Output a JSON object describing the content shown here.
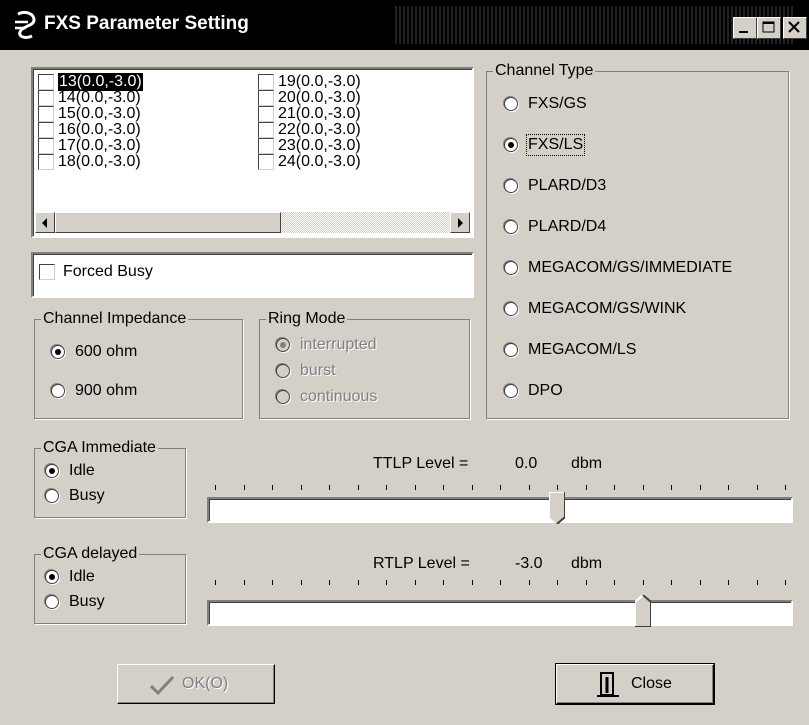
{
  "window": {
    "title": "FXS Parameter Setting"
  },
  "channels": {
    "left": [
      "13(0.0,-3.0)",
      "14(0.0,-3.0)",
      "15(0.0,-3.0)",
      "16(0.0,-3.0)",
      "17(0.0,-3.0)",
      "18(0.0,-3.0)"
    ],
    "right": [
      "19(0.0,-3.0)",
      "20(0.0,-3.0)",
      "21(0.0,-3.0)",
      "22(0.0,-3.0)",
      "23(0.0,-3.0)",
      "24(0.0,-3.0)"
    ],
    "selected": "13(0.0,-3.0)"
  },
  "forced_busy": {
    "label": "Forced Busy",
    "checked": false
  },
  "impedance": {
    "title": "Channel Impedance",
    "options": [
      "600 ohm",
      "900 ohm"
    ],
    "selected": "600 ohm"
  },
  "ring_mode": {
    "title": "Ring Mode",
    "options": [
      "interrupted",
      "burst",
      "continuous"
    ],
    "selected": "interrupted",
    "enabled": false
  },
  "channel_type": {
    "title": "Channel Type",
    "options": [
      "FXS/GS",
      "FXS/LS",
      "PLARD/D3",
      "PLARD/D4",
      "MEGACOM/GS/IMMEDIATE",
      "MEGACOM/GS/WINK",
      "MEGACOM/LS",
      "DPO"
    ],
    "selected": "FXS/LS"
  },
  "cga_immediate": {
    "title": "CGA Immediate",
    "options": [
      "Idle",
      "Busy"
    ],
    "selected": "Idle"
  },
  "cga_delayed": {
    "title": "CGA delayed",
    "options": [
      "Idle",
      "Busy"
    ],
    "selected": "Idle"
  },
  "ttlp": {
    "label": "TTLP Level =",
    "value": "0.0",
    "unit": "dbm",
    "position_fraction": 0.6
  },
  "rtlp": {
    "label": "RTLP Level =",
    "value": "-3.0",
    "unit": "dbm",
    "position_fraction": 0.75
  },
  "buttons": {
    "ok": "OK(O)",
    "close": "Close"
  },
  "icons": {
    "app": "app-icon",
    "minimize": "minimize-icon",
    "maximize": "maximize-icon",
    "close": "close-x-icon",
    "ok": "checkmark-icon",
    "close_button": "door-exit-icon"
  }
}
